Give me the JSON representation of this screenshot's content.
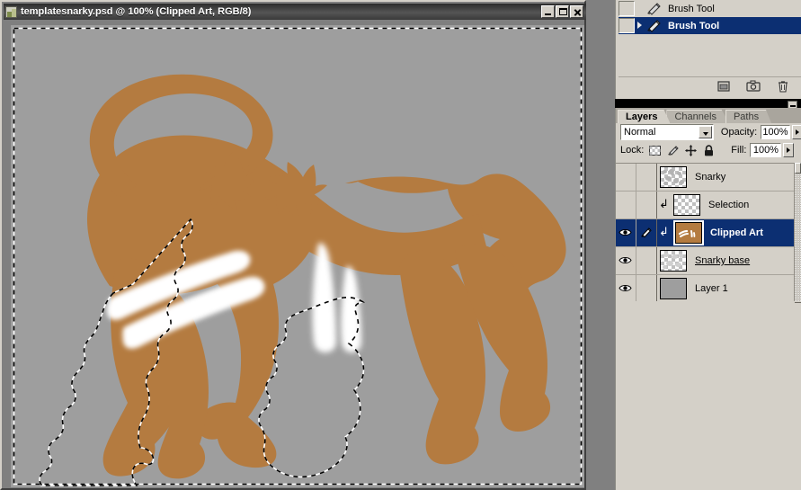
{
  "document_window": {
    "title": "templatesnarky.psd @ 100% (Clipped Art, RGB/8)",
    "icon": "photoshop-document-icon",
    "minimize_label": "Minimize",
    "maximize_label": "Maximize",
    "close_label": "Close",
    "zoom": "100%",
    "color_mode": "RGB/8",
    "active_layer": "Clipped Art"
  },
  "canvas": {
    "background_color": "#9e9e9e",
    "artwork_color": "#b47b40",
    "stroke_color": "#ffffff",
    "selection_style": "marching-ants",
    "subject": "lion-silhouette"
  },
  "history_panel": {
    "collapse_label": "Collapse",
    "states": [
      {
        "label": "Brush Tool",
        "icon": "brush-icon",
        "selected": false
      },
      {
        "label": "Brush Tool",
        "icon": "brush-icon",
        "selected": true
      }
    ],
    "buttons": [
      {
        "name": "new-document-from-state-button",
        "icon": "document-icon"
      },
      {
        "name": "create-new-snapshot-button",
        "icon": "camera-icon"
      },
      {
        "name": "delete-state-button",
        "icon": "trash-icon"
      }
    ]
  },
  "layers_panel": {
    "tabs": [
      {
        "label": "Layers",
        "active": true
      },
      {
        "label": "Channels",
        "active": false
      },
      {
        "label": "Paths",
        "active": false
      }
    ],
    "blend_mode": "Normal",
    "opacity_label": "Opacity:",
    "opacity_value": "100%",
    "lock_label": "Lock:",
    "fill_label": "Fill:",
    "fill_value": "100%",
    "lock_icons": [
      {
        "name": "lock-transparent-pixels-icon"
      },
      {
        "name": "lock-image-pixels-icon"
      },
      {
        "name": "lock-position-icon"
      },
      {
        "name": "lock-all-icon"
      }
    ],
    "layers": [
      {
        "name": "Snarky",
        "visible": false,
        "active": false,
        "clipped": false,
        "thumb": "checker-speckle",
        "underline": false
      },
      {
        "name": "Selection",
        "visible": false,
        "active": false,
        "clipped": true,
        "thumb": "checker",
        "underline": false
      },
      {
        "name": "Clipped Art",
        "visible": true,
        "active": true,
        "clipped": true,
        "thumb": "orange",
        "underline": false,
        "editing": true
      },
      {
        "name": "Snarky base",
        "visible": true,
        "active": false,
        "clipped": false,
        "thumb": "checker-speckle",
        "underline": true
      },
      {
        "name": "Layer 1",
        "visible": true,
        "active": false,
        "clipped": false,
        "thumb": "solid-gray",
        "underline": false
      }
    ]
  },
  "colors": {
    "panel_bg": "#d4d0c8",
    "selection_blue": "#0c2f72",
    "canvas_gray": "#9e9e9e",
    "art_orange": "#b47b40",
    "window_gray": "#7f7f7f"
  }
}
